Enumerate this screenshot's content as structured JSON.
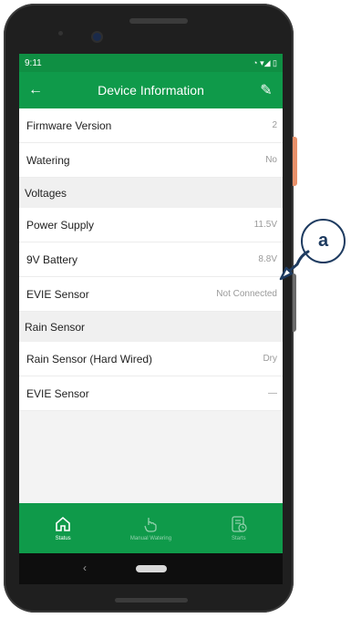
{
  "status_bar": {
    "time": "9:11",
    "icons": "◔ ▾◢ ▯"
  },
  "header": {
    "title": "Device Information",
    "back_icon": "←",
    "edit_icon": "✎"
  },
  "rows_top": [
    {
      "label": "Firmware Version",
      "value": "2"
    },
    {
      "label": "Watering",
      "value": "No"
    }
  ],
  "voltages": {
    "title": "Voltages",
    "rows": [
      {
        "label": "Power Supply",
        "value": "11.5V"
      },
      {
        "label": "9V Battery",
        "value": "8.8V"
      },
      {
        "label": "EVIE Sensor",
        "value": "Not Connected"
      }
    ]
  },
  "rain_sensor": {
    "title": "Rain Sensor",
    "rows": [
      {
        "label": "Rain Sensor (Hard Wired)",
        "value": "Dry"
      },
      {
        "label": "EVIE Sensor",
        "value": "—"
      }
    ]
  },
  "bottom_nav": [
    {
      "label": "Status",
      "icon": "home"
    },
    {
      "label": "Manual Watering",
      "icon": "hand-pointer"
    },
    {
      "label": "Starts",
      "icon": "schedule"
    }
  ],
  "annotation": {
    "letter": "a"
  },
  "colors": {
    "primary": "#0f9a4a",
    "annotation": "#1e3b60"
  }
}
